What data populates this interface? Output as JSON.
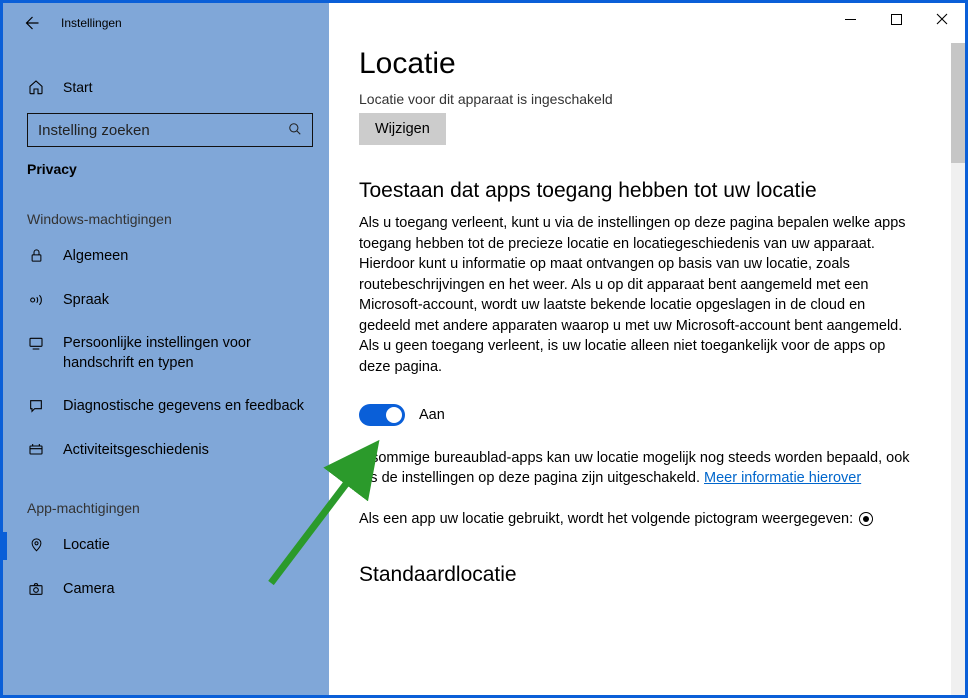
{
  "app": {
    "title": "Instellingen"
  },
  "sidebar": {
    "home_label": "Start",
    "search_placeholder": "Instelling zoeken",
    "category": "Privacy",
    "section1": "Windows-machtigingen",
    "items1": [
      {
        "label": "Algemeen"
      },
      {
        "label": "Spraak"
      },
      {
        "label": "Persoonlijke instellingen voor handschrift en typen"
      },
      {
        "label": "Diagnostische gegevens en feedback"
      },
      {
        "label": "Activiteitsgeschiedenis"
      }
    ],
    "section2": "App-machtigingen",
    "items2": [
      {
        "label": "Locatie"
      },
      {
        "label": "Camera"
      }
    ]
  },
  "main": {
    "page_title": "Locatie",
    "cut_line": "Locatie voor dit apparaat is ingeschakeld",
    "change_btn": "Wijzigen",
    "allow_heading": "Toestaan dat apps toegang hebben tot uw locatie",
    "allow_body": "Als u toegang verleent, kunt u via de instellingen op deze pagina bepalen welke apps toegang hebben tot de precieze locatie en locatiegeschiedenis van uw apparaat. Hierdoor kunt u informatie op maat ontvangen op basis van uw locatie, zoals routebeschrijvingen en het weer. Als u op dit apparaat bent aangemeld met een Microsoft-account, wordt uw laatste bekende locatie opgeslagen in de cloud en gedeeld met andere apparaten waarop u met uw Microsoft-account bent aangemeld. Als u geen toegang verleent, is uw locatie alleen niet toegankelijk voor de apps op deze pagina.",
    "toggle_state": "Aan",
    "desktop_para_prefix": "n sommige bureaublad-apps kan uw locatie mogelijk nog steeds worden bepaald, ook als de instellingen op deze pagina zijn uitgeschakeld. ",
    "more_info_link": "Meer informatie hierover",
    "indicator_para": "Als een app uw locatie gebruikt, wordt het volgende pictogram weergegeven: ",
    "default_heading": "Standaardlocatie"
  }
}
